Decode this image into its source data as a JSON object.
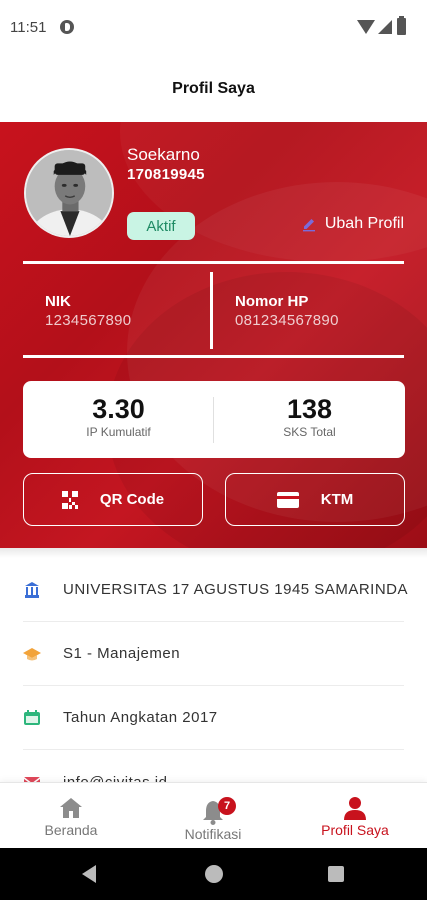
{
  "status_bar": {
    "time": "11:51"
  },
  "header": {
    "title": "Profil Saya"
  },
  "profile": {
    "name": "Soekarno",
    "student_id": "170819945",
    "status": "Aktif",
    "edit_label": "Ubah Profil",
    "nik_label": "NIK",
    "nik_value": "1234567890",
    "phone_label": "Nomor HP",
    "phone_value": "081234567890"
  },
  "stats": {
    "ipk_value": "3.30",
    "ipk_label": "IP Kumulatif",
    "sks_value": "138",
    "sks_label": "SKS Total"
  },
  "actions": {
    "qr_label": "QR Code",
    "ktm_label": "KTM"
  },
  "details": [
    {
      "icon": "university-icon",
      "text": "UNIVERSITAS 17 AGUSTUS 1945 SAMARINDA"
    },
    {
      "icon": "graduation-cap-icon",
      "text": "S1 - Manajemen"
    },
    {
      "icon": "calendar-icon",
      "text": "Tahun Angkatan 2017"
    },
    {
      "icon": "mail-icon",
      "text": "info@civitas.id"
    }
  ],
  "bottom_nav": {
    "home_label": "Beranda",
    "notif_label": "Notifikasi",
    "notif_count": "7",
    "profile_label": "Profil Saya"
  },
  "colors": {
    "brand_red": "#c8121d",
    "chip_green": "#c9f4e4",
    "chip_text": "#1f8a64"
  }
}
